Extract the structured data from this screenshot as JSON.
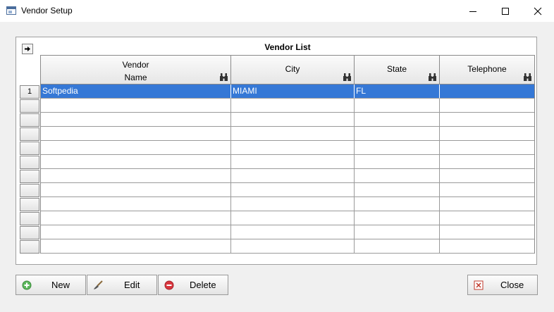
{
  "window": {
    "title": "Vendor Setup"
  },
  "list": {
    "title": "Vendor List",
    "columns": [
      {
        "line1": "Vendor",
        "line2": "Name"
      },
      {
        "line1": "City"
      },
      {
        "line1": "State"
      },
      {
        "line1": "Telephone"
      }
    ],
    "rows": [
      {
        "num": "1",
        "name": "Softpedia",
        "city": "MIAMI",
        "state": "FL",
        "phone": ""
      }
    ],
    "empty_rows": 11,
    "selected_row_color": "#3578d6"
  },
  "buttons": {
    "new": "New",
    "edit": "Edit",
    "delete": "Delete",
    "close": "Close"
  }
}
